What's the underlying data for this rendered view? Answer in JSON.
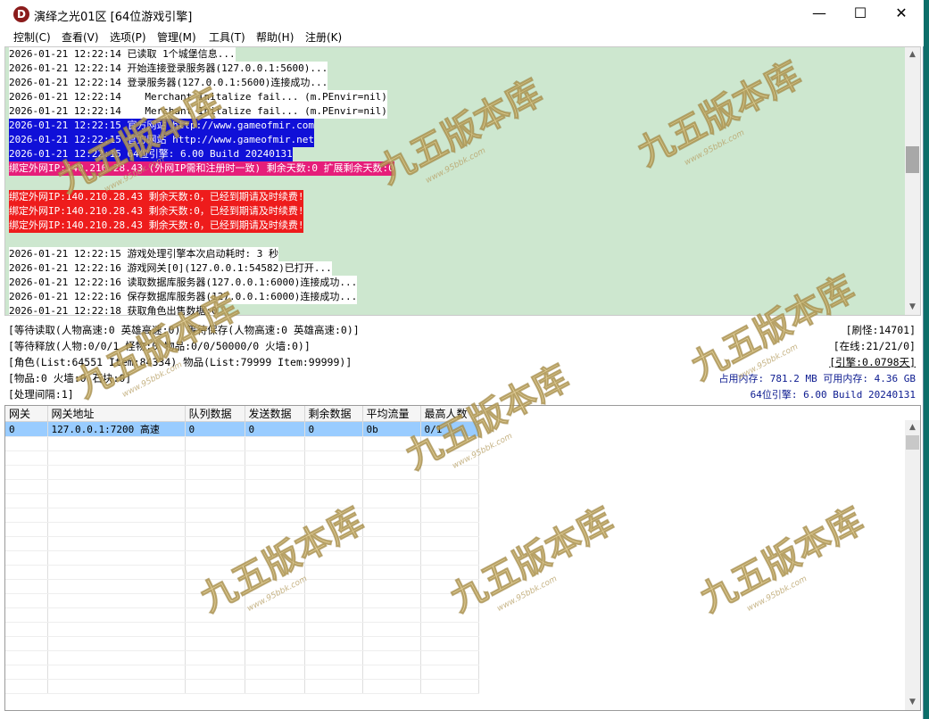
{
  "window": {
    "title": "演绎之光01区 [64位游戏引擎]",
    "icon_letter": "D",
    "icon_color": "#8b1c1c",
    "minimize_glyph": "—",
    "maximize_glyph": "☐",
    "close_glyph": "✕"
  },
  "menu": [
    {
      "label": "控制(C)"
    },
    {
      "label": "查看(V)"
    },
    {
      "label": "选项(P)"
    },
    {
      "label": "管理(M)"
    },
    {
      "label": "工具(T)"
    },
    {
      "label": "帮助(H)"
    },
    {
      "label": "注册(K)"
    }
  ],
  "log": {
    "background": "#cde7cf",
    "lines": [
      {
        "text": "2026-01-21 12:22:14 已读取 1个城堡信息...",
        "style": "white"
      },
      {
        "text": "2026-01-21 12:22:14 开始连接登录服务器(127.0.0.1:5600)...",
        "style": "white"
      },
      {
        "text": "2026-01-21 12:22:14 登录服务器(127.0.0.1:5600)连接成功...",
        "style": "white"
      },
      {
        "text": "2026-01-21 12:22:14    Merchant Initalize fail... (m.PEnvir=nil)",
        "style": "white"
      },
      {
        "text": "2026-01-21 12:22:14    Merchant Initalize fail... (m.PEnvir=nil)",
        "style": "white"
      },
      {
        "text": "2026-01-21 12:22:15 官方网站 http://www.gameofmir.com",
        "style": "blue"
      },
      {
        "text": "2026-01-21 12:22:15 官方网站 http://www.gameofmir.net",
        "style": "blue"
      },
      {
        "text": "2026-01-21 12:22:15 64位引擎: 6.00 Build 20240131",
        "style": "blue"
      },
      {
        "text": "绑定外网IP:140.210.28.43 (外网IP需和注册时一致) 剩余天数:0 扩展剩余天数:0",
        "style": "pink"
      },
      {
        "text": "",
        "style": "none"
      },
      {
        "text": "绑定外网IP:140.210.28.43 剩余天数:0，已经到期请及时续费!",
        "style": "red"
      },
      {
        "text": "绑定外网IP:140.210.28.43 剩余天数:0，已经到期请及时续费!",
        "style": "red"
      },
      {
        "text": "绑定外网IP:140.210.28.43 剩余天数:0，已经到期请及时续费!",
        "style": "red"
      },
      {
        "text": "",
        "style": "none"
      },
      {
        "text": "2026-01-21 12:22:15 游戏处理引擎本次启动耗时: 3 秒",
        "style": "white"
      },
      {
        "text": "2026-01-21 12:22:16 游戏网关[0](127.0.0.1:54582)已打开...",
        "style": "white"
      },
      {
        "text": "2026-01-21 12:22:16 读取数据库服务器(127.0.0.1:6000)连接成功...",
        "style": "white"
      },
      {
        "text": "2026-01-21 12:22:16 保存数据库服务器(127.0.0.1:6000)连接成功...",
        "style": "white"
      },
      {
        "text": "2026-01-21 12:22:18 获取角色出售数据:0",
        "style": "white"
      }
    ]
  },
  "status": {
    "left": [
      "[等待读取(人物高速:0 英雄高速:0) 等待保存(人物高速:0 英雄高速:0)]",
      "[等待释放(人物:0/0/1 怪物:0 物品:0/0/50000/0 火墙:0)]",
      "[角色(List:64551 Item:84334) 物品(List:79999 Item:99999)]",
      "[物品:0 火墙:0 石块:0]",
      "[处理间隔:1]"
    ],
    "monsters": "[刷怪:14701]",
    "online": "[在线:21/21/0]",
    "engine_time": "[引擎:0.0798天]",
    "memory": "占用内存: 781.2 MB 可用内存: 4.36 GB",
    "build": "64位引擎: 6.00 Build 20240131"
  },
  "gateway_table": {
    "headers": [
      "网关",
      "网关地址",
      "队列数据",
      "发送数据",
      "剩余数据",
      "平均流量",
      "最高人数"
    ],
    "rows": [
      [
        "0",
        "127.0.0.1:7200 高速",
        "0",
        "0",
        "0",
        "0b",
        "0/1"
      ]
    ]
  },
  "watermark": {
    "text": "九五版本库",
    "url": "www.95bbk.com"
  }
}
